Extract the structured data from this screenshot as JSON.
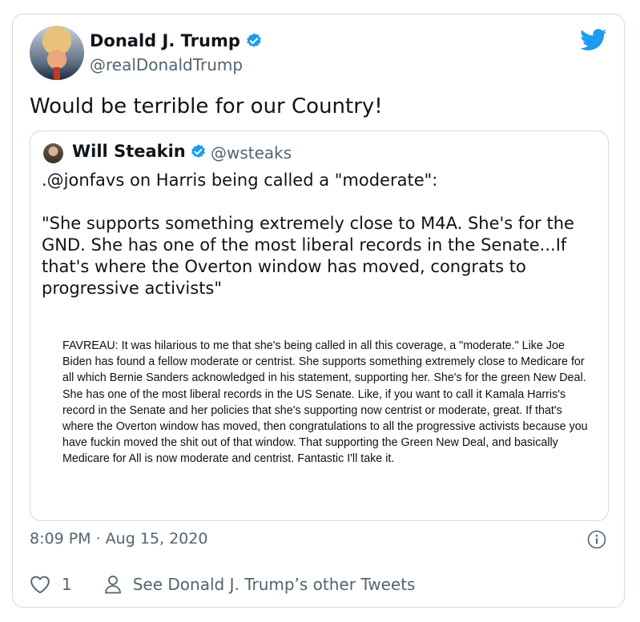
{
  "author": {
    "name": "Donald J. Trump",
    "handle": "@realDonaldTrump"
  },
  "tweet": {
    "text": "Would be terrible for our Country!",
    "timestamp": "8:09 PM · Aug 15, 2020"
  },
  "quoted": {
    "name": "Will Steakin",
    "handle": "@wsteaks",
    "text": ".@jonfavs on Harris being called a \"moderate\":\n\n\"She supports something extremely close to M4A. She's for the GND. She has one of the most liberal records in the Senate...If that's where the Overton window has moved, congrats to progressive activists\"",
    "image_text": "FAVREAU: It was hilarious to me that she's being called in all this coverage, a \"moderate.\" Like Joe Biden has found a fellow moderate or centrist. She supports something extremely close to Medicare for all which Bernie Sanders acknowledged in his statement, supporting her. She's for the green New Deal. She has one of the most liberal records in the US Senate. Like, if you want to call it Kamala Harris's record in the Senate and her policies that she's supporting now centrist or moderate, great. If that's where the Overton window has moved, then congratulations to all the progressive activists because you have fuckin moved the shit out of that window. That supporting the Green New Deal, and basically Medicare for All is now moderate and centrist. Fantastic I'll take it."
  },
  "actions": {
    "like_count": "1",
    "see_other_label": "See Donald J. Trump’s other Tweets"
  },
  "icons": {
    "verified": "verified-badge-icon",
    "brand": "twitter-bird-icon",
    "info": "info-icon",
    "like": "heart-icon",
    "profile": "person-icon"
  },
  "colors": {
    "brand_blue": "#1d9bf0",
    "secondary_text": "#536471",
    "border": "#cfd9de"
  }
}
